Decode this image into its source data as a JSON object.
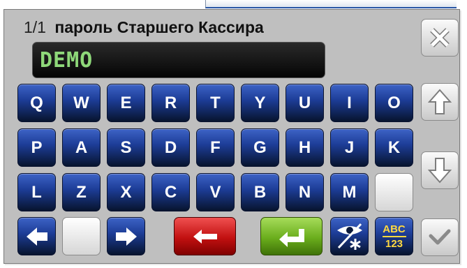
{
  "header": {
    "counter": "1/1",
    "caption": "пароль Старшего Кассира"
  },
  "display": {
    "value": "DEMO"
  },
  "keyboard": {
    "row1": [
      "Q",
      "W",
      "E",
      "R",
      "T",
      "Y",
      "U",
      "I",
      "O"
    ],
    "row2": [
      "P",
      "A",
      "S",
      "D",
      "F",
      "G",
      "H",
      "J",
      "K"
    ],
    "row3": [
      "L",
      "Z",
      "X",
      "C",
      "V",
      "B",
      "N",
      "M"
    ],
    "mode_key": {
      "top": "ABC",
      "bottom": "123"
    }
  },
  "icons": {
    "close": "close-icon",
    "up": "arrow-up-icon",
    "down": "arrow-down-icon",
    "confirm": "check-icon",
    "cursor_left": "arrow-left-icon",
    "cursor_right": "arrow-right-icon",
    "backspace": "backspace-arrow-icon",
    "enter": "enter-icon",
    "visibility": "eye-asterisk-icon"
  },
  "colors": {
    "key_blue": "#1d3d97",
    "backspace_red": "#c11010",
    "enter_green": "#6aad1c",
    "display_text": "#8ed879",
    "abc_yellow": "#ffd940"
  }
}
